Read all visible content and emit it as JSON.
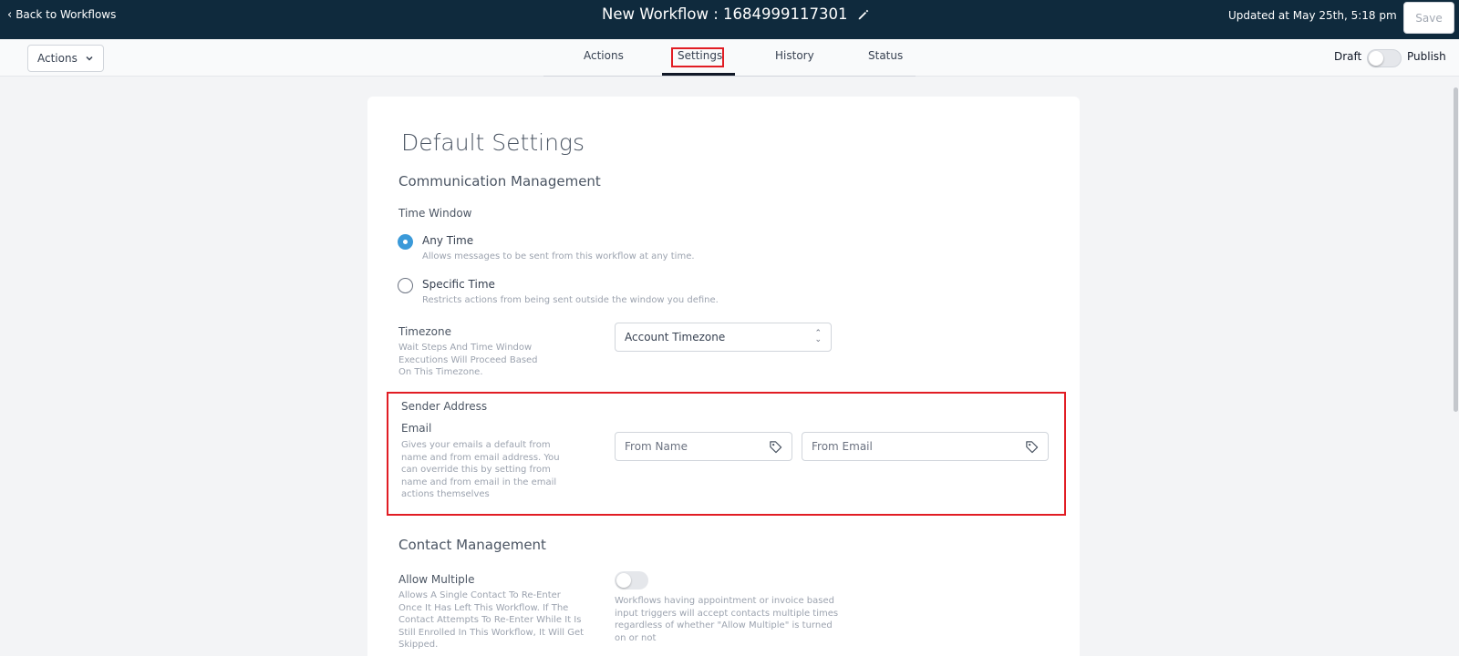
{
  "topbar": {
    "back_label": "Back to Workflows",
    "workflow_title": "New Workflow : 1684999117301",
    "updated_text": "Updated at May 25th, 5:18 pm",
    "save_label": "Save"
  },
  "subbar": {
    "actions_dropdown": "Actions",
    "tabs": [
      {
        "label": "Actions",
        "active": false
      },
      {
        "label": "Settings",
        "active": true
      },
      {
        "label": "History",
        "active": false
      },
      {
        "label": "Status",
        "active": false
      }
    ],
    "draft_label": "Draft",
    "publish_label": "Publish",
    "publish_toggle_on": false
  },
  "settings": {
    "title": "Default Settings",
    "communication": {
      "heading": "Communication Management",
      "time_window_label": "Time Window",
      "options": [
        {
          "label": "Any Time",
          "description": "Allows messages to be sent from this workflow at any time.",
          "selected": true
        },
        {
          "label": "Specific Time",
          "description": "Restricts actions from being sent outside the window you define.",
          "selected": false
        }
      ],
      "timezone_label": "Timezone",
      "timezone_desc_lines": [
        "Wait Steps And Time Window",
        "Executions Will Proceed Based",
        "On This Timezone."
      ],
      "timezone_value": "Account Timezone"
    },
    "sender": {
      "heading": "Sender Address",
      "email_label": "Email",
      "email_desc_lines": [
        "Gives your emails a default from",
        "name and from email address. You",
        "can override this by setting from",
        "name and from email in the email",
        "actions themselves"
      ],
      "from_name_placeholder": "From Name",
      "from_email_placeholder": "From Email"
    },
    "contact": {
      "heading": "Contact Management",
      "allow_multiple_label": "Allow Multiple",
      "allow_multiple_desc_lines": [
        "Allows A Single Contact To Re-Enter",
        "Once It Has Left This Workflow. If The",
        "Contact Attempts To Re-Enter While It Is",
        "Still Enrolled In This Workflow, It Will Get",
        "Skipped."
      ],
      "allow_multiple_on": false,
      "allow_multiple_note_lines": [
        "Workflows having appointment or invoice based",
        "input triggers will accept contacts multiple times",
        "regardless of whether \"Allow Multiple\" is turned",
        "on or not"
      ]
    }
  },
  "colors": {
    "topbar_bg": "#0f2a3d",
    "accent_radio": "#3b9ad9",
    "highlight_red": "#e11d24"
  }
}
